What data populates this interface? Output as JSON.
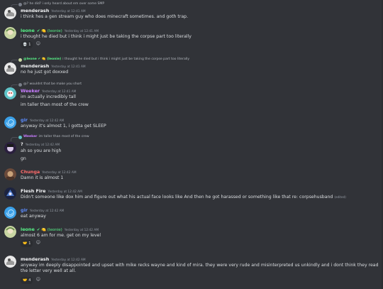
{
  "colors": {
    "bg": "#313338",
    "white_name": "#f2f3f5",
    "leone": "#57f287",
    "weeker": "#c87dff",
    "blue_name": "#5b8cff",
    "chunga": "#ff6b6b"
  },
  "messages": [
    {
      "reply": {
        "name": "",
        "text": "@? he did? i only heard about em over some SMP"
      },
      "name": "menderash",
      "badges": "",
      "time": "Yesterday at 12:41 AM",
      "lines": [
        "i think hes a gen stream guy who does minecraft sometimes. and goth trap."
      ]
    },
    {
      "name": "leone",
      "badges": "✔ 🍋 (leonie)",
      "time": "Yesterday at 12:41 AM",
      "lines": [
        "i thought he died but i think i might just be taking the corpse part too literally"
      ],
      "reactions": [
        {
          "emoji": "💀",
          "count": "1"
        }
      ]
    },
    {
      "reply": {
        "name": "@leone ✔ 🍋 (leonie)",
        "text": "i thought he died but i think i might just be taking the corpse part too literally"
      },
      "name": "menderash",
      "badges": "",
      "time": "Yesterday at 12:41 AM",
      "lines": [
        "no he just got doxxed"
      ]
    },
    {
      "reply": {
        "name": "",
        "text": "@? wouldnt that be make you short"
      },
      "name": "Weeker",
      "badges": "",
      "time": "Yesterday at 12:41 AM",
      "lines": [
        "im actually incredibly tall",
        "im taller than most of the crew"
      ]
    },
    {
      "name": "gir",
      "badges": "",
      "time": "Yesterday at 12:42 AM",
      "lines": [
        "anyway it's almost 1, i gotta get SLEEP"
      ]
    },
    {
      "reply": {
        "name": "Weeker",
        "text": "im taller than most of the crew"
      },
      "name": "?",
      "badges": "",
      "time": "Yesterday at 12:42 AM",
      "lines": [
        "ah so you are high",
        "gn"
      ]
    },
    {
      "name": "Chunga",
      "badges": "",
      "time": "Yesterday at 12:42 AM",
      "lines": [
        "Damn it is almost 1"
      ]
    },
    {
      "name": "Flesh Fire",
      "badges": "",
      "time": "Yesterday at 12:42 AM",
      "lines": [
        "Didn't someone like dox him and figure out what his actual face looks like And then he got harassed or something like that re: corpsehusband"
      ],
      "edited": "(edited)"
    },
    {
      "name": "gir",
      "badges": "",
      "time": "Yesterday at 12:42 AM",
      "lines": [
        "eat anyway"
      ]
    },
    {
      "name": "leone",
      "badges": "✔ 🍋 (leonie)",
      "time": "Yesterday at 12:42 AM",
      "lines": [
        "almost 6 am for me. get on my level"
      ],
      "reactions": [
        {
          "emoji": "🤝",
          "count": "1"
        }
      ]
    },
    {
      "name": "menderash",
      "badges": "",
      "time": "Yesterday at 12:42 AM",
      "lines": [
        "anyway im deeply disappointed and upset with mike recks wayne and kind of mira. they were very rude and misinterpreted us unkindly and i dont think they read the letter very well at all."
      ],
      "reactions": [
        {
          "emoji": "🤝",
          "count": "4"
        }
      ]
    }
  ]
}
